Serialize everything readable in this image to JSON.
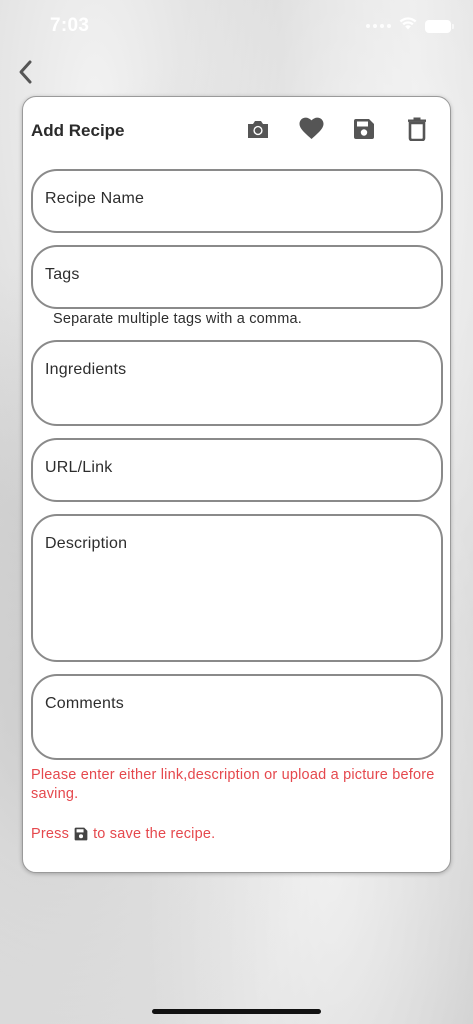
{
  "status_bar": {
    "time": "7:03"
  },
  "navigation": {
    "back_icon": "chevron-left-icon"
  },
  "card": {
    "title": "Add Recipe",
    "toolbar": [
      {
        "name": "camera-icon"
      },
      {
        "name": "heart-icon"
      },
      {
        "name": "save-icon"
      },
      {
        "name": "trash-icon"
      }
    ]
  },
  "form": {
    "recipe_name": {
      "label": "Recipe Name",
      "value": ""
    },
    "tags": {
      "label": "Tags",
      "value": "",
      "helper": "Separate multiple tags with a comma."
    },
    "ingredients": {
      "label": "Ingredients",
      "value": ""
    },
    "url": {
      "label": "URL/Link",
      "value": ""
    },
    "description": {
      "label": "Description",
      "value": ""
    },
    "comments": {
      "label": "Comments",
      "value": ""
    }
  },
  "messages": {
    "error": "Please enter either link,description or upload a picture before saving.",
    "hint_before": "Press",
    "hint_after": "to save the recipe."
  },
  "colors": {
    "error": "#e5484d",
    "icon": "#555555",
    "field_border": "#8a8a8a"
  }
}
